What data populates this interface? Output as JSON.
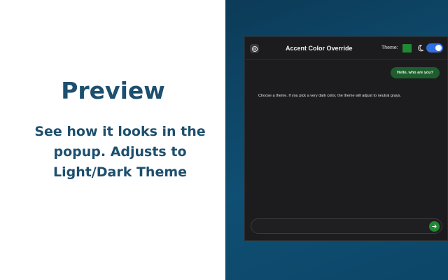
{
  "promo": {
    "heading": "Preview",
    "subtext": "See how it looks in the popup. Adjusts to Light/Dark Theme"
  },
  "popup": {
    "app_icon": "openai-logo-icon",
    "title": "Accent Color Override",
    "theme_label": "Theme:",
    "accent_color": "#1f8a33",
    "theme_icon": "moon-icon",
    "dark_mode_toggle": "on",
    "messages": {
      "user": "Hello, who are you?",
      "assistant": "Choose a theme. If you pick a very dark color, the theme will adjust to neutral grays."
    },
    "composer": {
      "value": "",
      "placeholder": "",
      "send_icon": "send-icon"
    }
  }
}
